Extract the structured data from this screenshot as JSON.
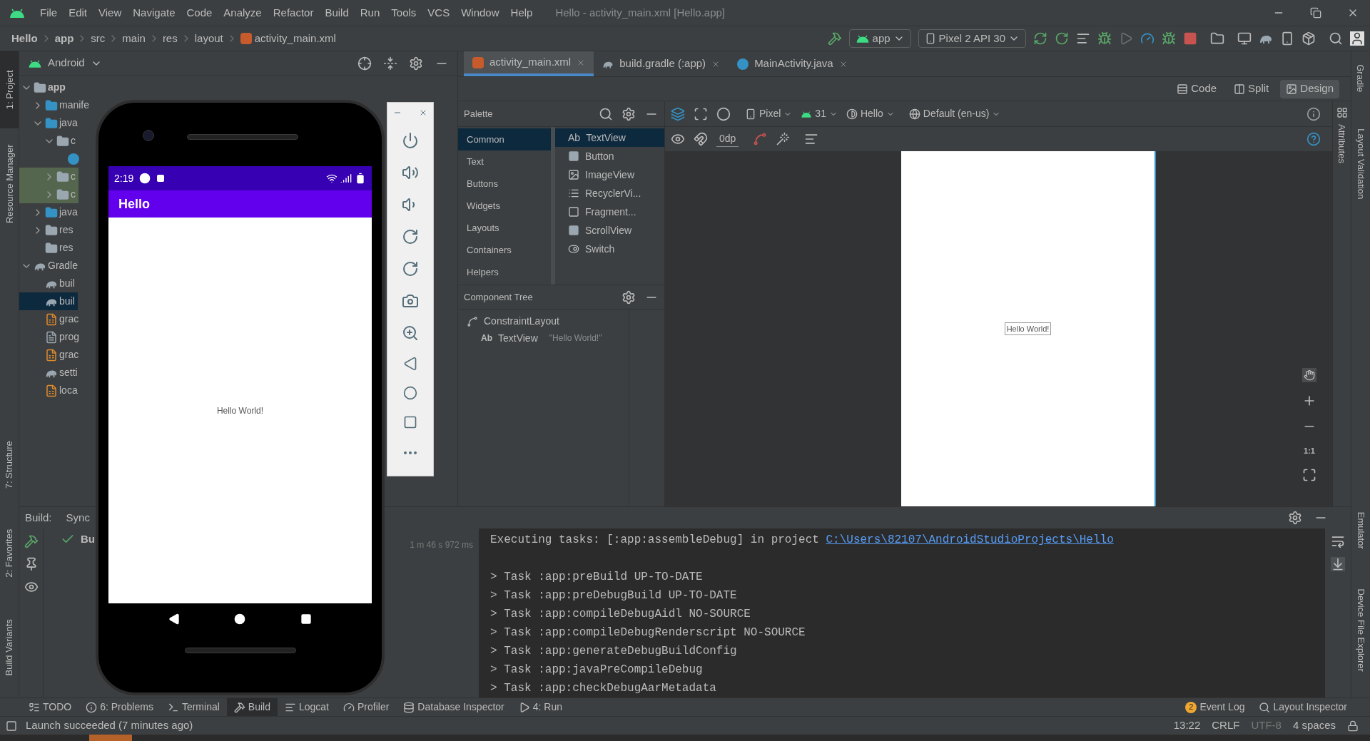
{
  "title_bar": {
    "menus": [
      "File",
      "Edit",
      "View",
      "Navigate",
      "Code",
      "Analyze",
      "Refactor",
      "Build",
      "Run",
      "Tools",
      "VCS",
      "Window",
      "Help"
    ],
    "title": "Hello - activity_main.xml [Hello.app]"
  },
  "breadcrumbs": [
    "Hello",
    "app",
    "src",
    "main",
    "res",
    "layout",
    "activity_main.xml"
  ],
  "toolbar": {
    "config": "app",
    "device": "Pixel 2 API 30"
  },
  "left_strip_top": [
    {
      "label": "1: Project",
      "selected": true
    },
    {
      "label": "Resource Manager",
      "selected": false
    }
  ],
  "left_strip_bottom": [
    {
      "label": "7: Structure",
      "selected": false
    },
    {
      "label": "2: Favorites",
      "selected": false
    },
    {
      "label": "Build Variants",
      "selected": false
    }
  ],
  "right_strip_top": [
    "Gradle",
    "Layout Validation"
  ],
  "right_strip_bottom": [
    "Emulator",
    "Device File Explorer"
  ],
  "project": {
    "view": "Android",
    "tree": [
      {
        "label": "app",
        "kind": "module",
        "expanded": true,
        "selected": false,
        "tinted": false,
        "children": [
          {
            "label": "manife",
            "kind": "folder",
            "expanded": false,
            "selected": false,
            "tinted": false
          },
          {
            "label": "java",
            "kind": "folder",
            "expanded": true,
            "selected": false,
            "tinted": false,
            "children": [
              {
                "label": "c",
                "kind": "package",
                "expanded": true,
                "selected": false,
                "tinted": false,
                "children": [
                  {
                    "kind": "class",
                    "selected": false,
                    "tinted": false
                  }
                ]
              },
              {
                "label": "c",
                "kind": "package",
                "expanded": false,
                "selected": false,
                "tinted": true
              },
              {
                "label": "c",
                "kind": "package",
                "expanded": false,
                "selected": false,
                "tinted": true
              }
            ]
          },
          {
            "label": "java",
            "kind": "generated",
            "expanded": false,
            "selected": false,
            "tinted": false
          },
          {
            "label": "res",
            "kind": "res",
            "expanded": false,
            "selected": false,
            "tinted": false
          },
          {
            "label": "res",
            "kind": "res",
            "selected": false,
            "tinted": false
          }
        ]
      },
      {
        "label": "Gradle",
        "kind": "gradle",
        "expanded": true,
        "selected": false,
        "tinted": false,
        "children": [
          {
            "label": "buil",
            "kind": "gradle",
            "selected": false,
            "tinted": false
          },
          {
            "label": "buil",
            "kind": "gradle",
            "selected": true,
            "tinted": false
          },
          {
            "label": "grac",
            "kind": "properties",
            "selected": false,
            "tinted": false
          },
          {
            "label": "prog",
            "kind": "text",
            "selected": false,
            "tinted": false
          },
          {
            "label": "grac",
            "kind": "properties",
            "selected": false,
            "tinted": false
          },
          {
            "label": "setti",
            "kind": "gradle",
            "selected": false,
            "tinted": false
          },
          {
            "label": "loca",
            "kind": "properties",
            "selected": false,
            "tinted": false
          }
        ]
      }
    ]
  },
  "editor_tabs": [
    {
      "label": "activity_main.xml",
      "kind": "layout",
      "selected": true
    },
    {
      "label": "build.gradle (:app)",
      "kind": "gradle",
      "selected": false
    },
    {
      "label": "MainActivity.java",
      "kind": "class",
      "selected": false
    }
  ],
  "view_modes": [
    {
      "label": "Code",
      "selected": false
    },
    {
      "label": "Split",
      "selected": false
    },
    {
      "label": "Design",
      "selected": true
    }
  ],
  "palette": {
    "title": "Palette",
    "categories": [
      {
        "label": "Common",
        "selected": true
      },
      {
        "label": "Text",
        "selected": false
      },
      {
        "label": "Buttons",
        "selected": false
      },
      {
        "label": "Widgets",
        "selected": false
      },
      {
        "label": "Layouts",
        "selected": false
      },
      {
        "label": "Containers",
        "selected": false
      },
      {
        "label": "Helpers",
        "selected": false
      }
    ],
    "items": [
      {
        "label": "TextView",
        "kind": "text",
        "glyph": "Ab",
        "selected": true
      },
      {
        "label": "Button",
        "kind": "button",
        "selected": false
      },
      {
        "label": "ImageView",
        "kind": "image",
        "selected": false
      },
      {
        "label": "RecyclerVi...",
        "kind": "list",
        "selected": false
      },
      {
        "label": "Fragment...",
        "kind": "fragment",
        "selected": false
      },
      {
        "label": "ScrollView",
        "kind": "scroll",
        "selected": false
      },
      {
        "label": "Switch",
        "kind": "switch",
        "selected": false
      }
    ]
  },
  "component_tree": {
    "title": "Component Tree",
    "nodes": [
      {
        "label": "ConstraintLayout",
        "children": [
          {
            "glyph": "Ab",
            "label": "TextView",
            "text": "\"Hello World!\""
          }
        ]
      }
    ]
  },
  "design_toolbar": {
    "device": "Pixel",
    "api": "31",
    "theme": "Hello",
    "locale": "Default (en-us)",
    "margin": "0dp"
  },
  "attributes_label": "Attributes",
  "preview": {
    "text": "Hello World!"
  },
  "zoom_actual": "1:1",
  "build": {
    "label": "Build:",
    "tabs": [
      {
        "label": "Sync",
        "selected": false
      }
    ],
    "tree_item": "Bu",
    "duration": "1 m 46 s 972 ms"
  },
  "console": {
    "header": "Executing tasks: [:app:assembleDebug] in project ",
    "link": "C:\\Users\\82107\\AndroidStudioProjects\\Hello",
    "lines": [
      "> Task :app:preBuild UP-TO-DATE",
      "> Task :app:preDebugBuild UP-TO-DATE",
      "> Task :app:compileDebugAidl NO-SOURCE",
      "> Task :app:compileDebugRenderscript NO-SOURCE",
      "> Task :app:generateDebugBuildConfig",
      "> Task :app:javaPreCompileDebug",
      "> Task :app:checkDebugAarMetadata"
    ]
  },
  "bottom_tools": [
    {
      "label": "TODO",
      "kind": "todo",
      "selected": false
    },
    {
      "label": "6: Problems",
      "kind": "problems",
      "selected": false
    },
    {
      "label": "Terminal",
      "kind": "terminal",
      "selected": false
    },
    {
      "label": "Build",
      "kind": "build",
      "selected": true
    },
    {
      "label": "Logcat",
      "kind": "logcat",
      "selected": false
    },
    {
      "label": "Profiler",
      "kind": "profiler",
      "selected": false
    },
    {
      "label": "Database Inspector",
      "kind": "database",
      "selected": false
    },
    {
      "label": "4: Run",
      "kind": "run",
      "selected": false
    }
  ],
  "bottom_tools_right": [
    {
      "label": "Event Log",
      "badge": "2"
    },
    {
      "label": "Layout Inspector"
    }
  ],
  "status": {
    "message": "Launch succeeded (7 minutes ago)",
    "position": "13:22",
    "line_separator": "CRLF",
    "encoding": "UTF-8",
    "indent": "4 spaces"
  },
  "emulator": {
    "time": "2:19",
    "app_title": "Hello",
    "text": "Hello World!"
  }
}
